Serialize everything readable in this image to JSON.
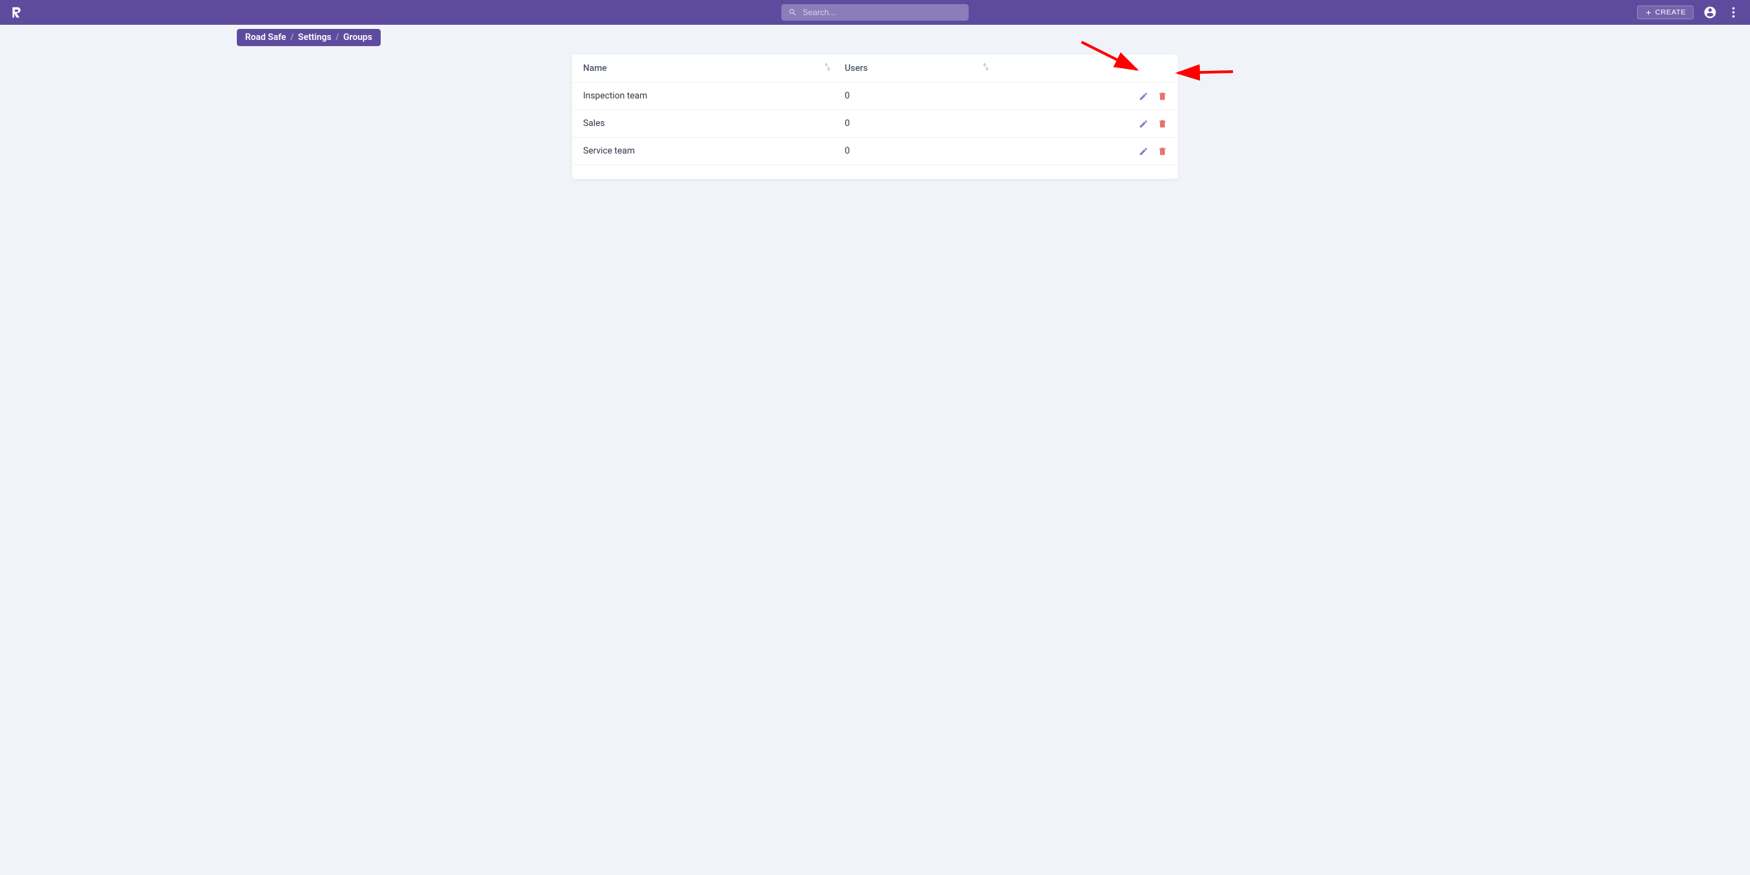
{
  "topbar": {
    "search_placeholder": "Search...",
    "create_label": "CREATE"
  },
  "breadcrumb": {
    "items": [
      "Road Safe",
      "Settings",
      "Groups"
    ],
    "separator": "/"
  },
  "table": {
    "columns": {
      "name": "Name",
      "users": "Users"
    },
    "rows": [
      {
        "name": "Inspection team",
        "users": "0"
      },
      {
        "name": "Sales",
        "users": "0"
      },
      {
        "name": "Service team",
        "users": "0"
      }
    ]
  }
}
